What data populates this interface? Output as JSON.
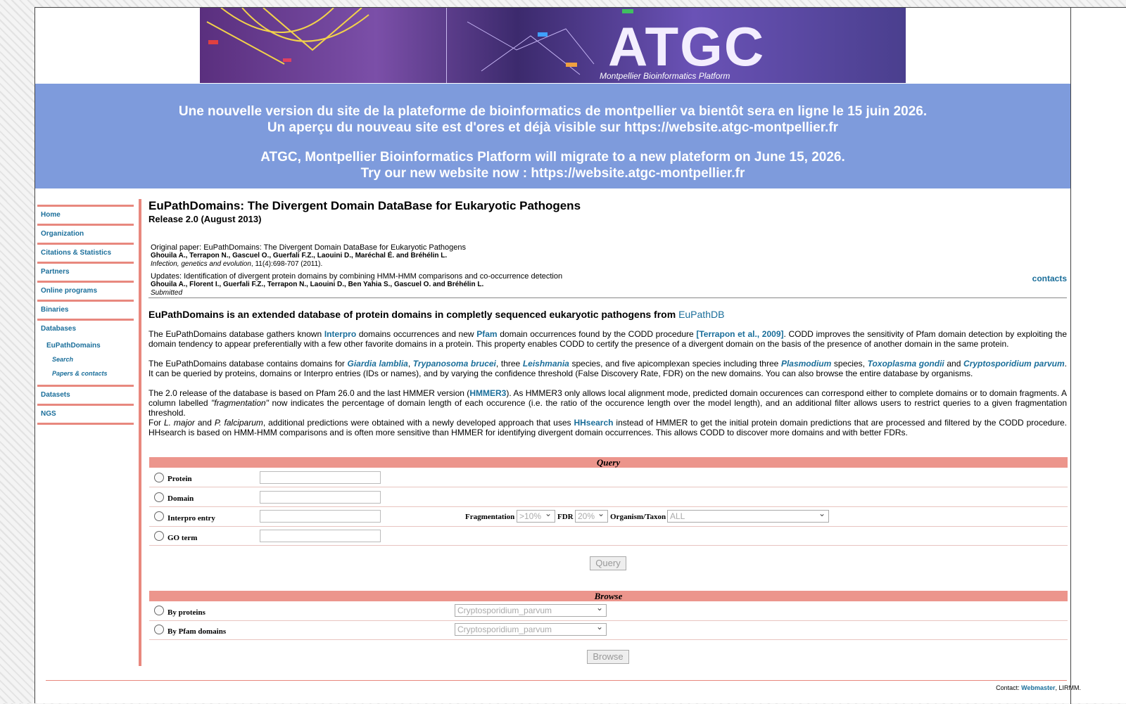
{
  "banner": {
    "logo_text": "ATGC",
    "subtitle": "Montpellier Bioinformatics Platform"
  },
  "notice": {
    "line1": "Une nouvelle version du site de la plateforme de bioinformatics de montpellier va bientôt sera en ligne le 15 juin 2026.",
    "line2": "Un aperçu du nouveau site est d'ores et déjà visible sur https://website.atgc-montpellier.fr",
    "line3": "ATGC, Montpellier Bioinformatics Platform will migrate to a new plateform on June 15, 2026.",
    "line4": "Try our new website now : https://website.atgc-montpellier.fr"
  },
  "sidebar": {
    "items": [
      {
        "label": "Home"
      },
      {
        "label": "Organization"
      },
      {
        "label": "Citations & Statistics"
      },
      {
        "label": "Partners"
      },
      {
        "label": "Online programs"
      },
      {
        "label": "Binaries"
      },
      {
        "label": "Databases"
      }
    ],
    "sub_label": "EuPathDomains",
    "subsub": [
      {
        "label": "Search"
      },
      {
        "label": "Papers & contacts"
      }
    ],
    "after": [
      {
        "label": "Datasets"
      },
      {
        "label": "NGS"
      }
    ]
  },
  "main": {
    "title": "EuPathDomains: The Divergent Domain DataBase for Eukaryotic Pathogens",
    "release": "Release 2.0 (August 2013)",
    "paper1": {
      "title": "Original paper: EuPathDomains: The Divergent Domain DataBase for Eukaryotic Pathogens",
      "authors": "Ghouila A., Terrapon N., Gascuel O., Guerfali F.Z., Laouini D., Maréchal É. and Bréhélin L.",
      "journal": "Infection, genetics and evolution",
      "ref": ", 11(4):698-707 (2011)."
    },
    "paper2": {
      "title": "Updates: Identification of divergent protein domains by combining HMM-HMM comparisons and co-occurrence detection",
      "authors": "Ghouila A., Florent I., Guerfali F.Z., Terrapon N., Laouini D., Ben Yahia S., Gascuel O. and Bréhélin L.",
      "status": "Submitted"
    },
    "contacts": "contacts",
    "intro_text": "EuPathDomains is an extended database of protein domains in completly sequenced eukaryotic pathogens from ",
    "intro_link": "EuPathDB",
    "p1": {
      "a": "The EuPathDomains database gathers known ",
      "interpro": "Interpro",
      "b": " domains occurrences and new ",
      "pfam": "Pfam",
      "c": " domain occurrences found by the CODD procedure ",
      "ref": "[Terrapon et al., 2009]",
      "d": ". CODD improves the sensitivity of Pfam domain detection by exploiting the domain tendency to appear preferentially with a few other favorite domains in a protein. This property enables CODD to certify the presence of a divergent domain on the basis of the presence of another domain in the same protein."
    },
    "p2": {
      "a": "The EuPathDomains database contains domains for ",
      "giardia": "Giardia lamblia",
      "comma": ", ",
      "tryp": "Trypanosoma brucei",
      "b": ", three ",
      "leish": "Leishmania",
      "c": " species, and five apicomplexan species including three ",
      "plasmo": "Plasmodium",
      "d": " species, ",
      "toxo": "Toxoplasma gondii",
      "e": " and ",
      "crypto": "Cryptosporidium parvum",
      "f": ". It can be queried by proteins, domains or Interpro entries (IDs or names), and by varying the confidence threshold (False Discovery Rate, FDR) on the new domains. You can also browse the entire database by organisms."
    },
    "p3": {
      "a": "The 2.0 release of the database is based on Pfam 26.0 and the last HMMER version (",
      "hmmer": "HMMER3",
      "b": "). As HMMER3 only allows local alignment mode, predicted domain occurences can correspond either to complete domains or to domain fragments. A column labelled ",
      "frag": "\"fragmentation\"",
      "c": " now indicates the percentage of domain length of each occurence (i.e. the ratio of the occurence length over the model length), and an additional filter allows users to restrict queries to a given fragmentation threshold."
    },
    "p4": {
      "a": "For ",
      "lmajor": "L. major",
      "b": " and ",
      "pfalc": "P. falciparum",
      "c": ", additional predictions were obtained with a newly developed approach that uses ",
      "hhsearch": "HHsearch",
      "d": " instead of HMMER to get the initial protein domain predictions that are processed and filtered by the CODD procedure. HHsearch is based on HMM-HMM comparisons and is often more sensitive than HMMER for identifying divergent domain occurrences. This allows CODD to discover more domains and with better FDRs."
    }
  },
  "query": {
    "header": "Query",
    "rows": [
      {
        "label": "Protein"
      },
      {
        "label": "Domain"
      },
      {
        "label": "Interpro entry"
      },
      {
        "label": "GO term"
      }
    ],
    "frag_label": "Fragmentation",
    "frag_value": ">10%",
    "fdr_label": "FDR",
    "fdr_value": "20%",
    "org_label": "Organism/Taxon",
    "org_value": "ALL",
    "button": "Query"
  },
  "browse": {
    "header": "Browse",
    "rows": [
      {
        "label": "By proteins",
        "value": "Cryptosporidium_parvum"
      },
      {
        "label": "By Pfam domains",
        "value": "Cryptosporidium_parvum"
      }
    ],
    "button": "Browse"
  },
  "footer": {
    "contact_prefix": "Contact: ",
    "webmaster": "Webmaster",
    "suffix": ", LIRMM."
  }
}
